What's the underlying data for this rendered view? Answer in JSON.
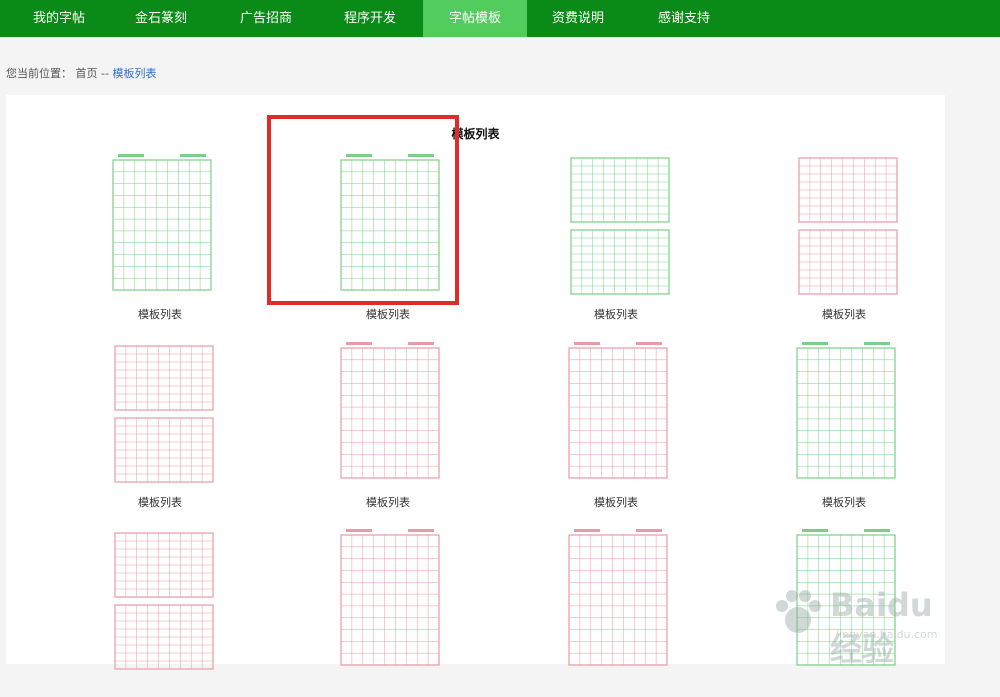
{
  "nav": {
    "items": [
      {
        "label": "我的字帖",
        "active": false
      },
      {
        "label": "金石篆刻",
        "active": false
      },
      {
        "label": "广告招商",
        "active": false
      },
      {
        "label": "程序开发",
        "active": false
      },
      {
        "label": "字帖模板",
        "active": true
      },
      {
        "label": "资费说明",
        "active": false
      },
      {
        "label": "感谢支持",
        "active": false
      }
    ]
  },
  "breadcrumb": {
    "prefix": "您当前位置：",
    "home": "首页",
    "separator": "--",
    "current": "模板列表"
  },
  "panel": {
    "title": "模板列表"
  },
  "templates": [
    {
      "caption": "模板列表",
      "color": "#7ccf86",
      "style": "single"
    },
    {
      "caption": "模板列表",
      "color": "#7ccf86",
      "style": "single"
    },
    {
      "caption": "模板列表",
      "color": "#7ccf86",
      "style": "double"
    },
    {
      "caption": "模板列表",
      "color": "#e89aa6",
      "style": "double"
    },
    {
      "caption": "模板列表",
      "color": "#e89aa6",
      "style": "double"
    },
    {
      "caption": "模板列表",
      "color": "#e89aa6",
      "style": "single"
    },
    {
      "caption": "模板列表",
      "color": "#e89aa6",
      "style": "single"
    },
    {
      "caption": "模板列表",
      "color": "#7ccf86",
      "style": "single"
    },
    {
      "caption": "",
      "color": "#e89aa6",
      "style": "double"
    },
    {
      "caption": "",
      "color": "#e89aa6",
      "style": "single"
    },
    {
      "caption": "",
      "color": "#e89aa6",
      "style": "single"
    },
    {
      "caption": "",
      "color": "#7ccf86",
      "style": "single"
    }
  ],
  "watermark": {
    "text": "Baidu经验",
    "sub": "jingyan.baidu.com"
  },
  "colors": {
    "nav_bg": "#0a8a16",
    "nav_active": "#52cc5c",
    "highlight": "#e12b2b"
  }
}
